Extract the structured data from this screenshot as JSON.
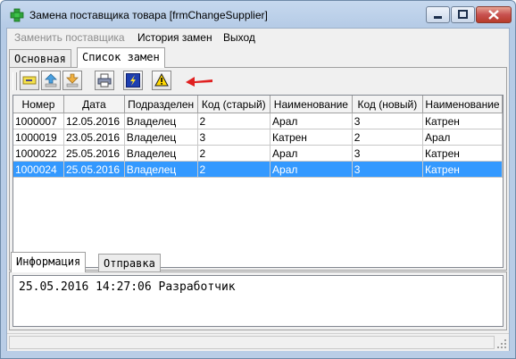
{
  "window": {
    "title": "Замена поставщика товара [frmChangeSupplier]"
  },
  "menu": {
    "items": [
      {
        "label": "Заменить поставщика",
        "enabled": false
      },
      {
        "label": "История замен",
        "enabled": true
      },
      {
        "label": "Выход",
        "enabled": true
      }
    ]
  },
  "top_tabs": [
    {
      "label": "Основная",
      "active": false
    },
    {
      "label": "Список замен",
      "active": true
    }
  ],
  "toolbar": {
    "buttons": [
      {
        "icon": "edit-icon"
      },
      {
        "icon": "upload-icon"
      },
      {
        "icon": "download-icon"
      },
      {
        "icon": "print-icon"
      },
      {
        "icon": "lightning-icon"
      },
      {
        "icon": "warning-icon"
      }
    ],
    "annotation": {
      "icon": "red-arrow-icon",
      "color": "#e02020"
    }
  },
  "grid": {
    "columns": [
      "Номер",
      "Дата",
      "Подразделен",
      "Код (старый)",
      "Наименование",
      "Код (новый)",
      "Наименование"
    ],
    "rows": [
      [
        "1000007",
        "12.05.2016",
        "Владелец",
        "2",
        "Арал",
        "3",
        "Катрен"
      ],
      [
        "1000019",
        "23.05.2016",
        "Владелец",
        "3",
        "Катрен",
        "2",
        "Арал"
      ],
      [
        "1000022",
        "25.05.2016",
        "Владелец",
        "2",
        "Арал",
        "3",
        "Катрен"
      ],
      [
        "1000024",
        "25.05.2016",
        "Владелец",
        "2",
        "Арал",
        "3",
        "Катрен"
      ]
    ],
    "selected_row": 3,
    "selection_color": "#3399ff"
  },
  "bottom_tabs": [
    {
      "label": "Информация",
      "active": true
    },
    {
      "label": "Отправка",
      "active": false
    }
  ],
  "info": {
    "text": "25.05.2016 14:27:06 Разработчик"
  }
}
